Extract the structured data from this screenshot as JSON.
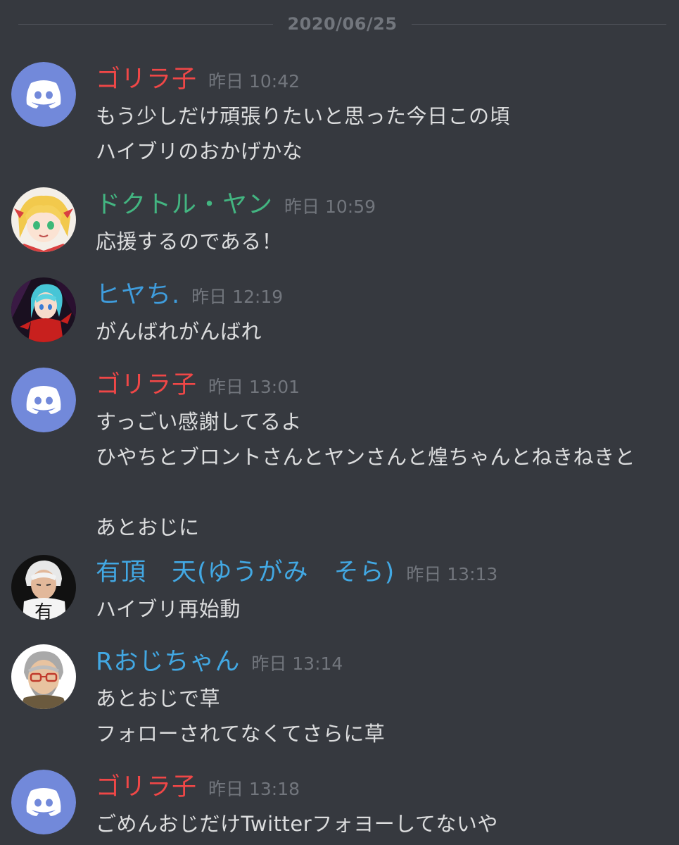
{
  "date_divider": "2020/06/25",
  "colors": {
    "red": "#f04747",
    "green": "#43b581",
    "blue": "#3f9ddd",
    "background": "#36393f",
    "discord_blurple": "#7289da"
  },
  "messages": [
    {
      "author": "ゴリラ子",
      "author_color": "red",
      "avatar": "discord-default-avatar",
      "timestamp": "昨日 10:42",
      "lines": [
        "もう少しだけ頑張りたいと思った今日この頃",
        "ハイブリのおかげかな"
      ]
    },
    {
      "author": "ドクトル・ヤン",
      "author_color": "green",
      "avatar": "anime-blonde-girl-avatar",
      "timestamp": "昨日 10:59",
      "lines": [
        "応援するのである！"
      ]
    },
    {
      "author": "ヒヤち.",
      "author_color": "blue",
      "avatar": "anime-cyan-hair-avatar",
      "timestamp": "昨日 12:19",
      "lines": [
        "がんばれがんばれ"
      ]
    },
    {
      "author": "ゴリラ子",
      "author_color": "red",
      "avatar": "discord-default-avatar",
      "timestamp": "昨日 13:01",
      "lines": [
        "すっごい感謝してるよ",
        "ひやちとブロントさんとヤンさんと煌ちゃんとねきねきと",
        "",
        "あとおじに"
      ]
    },
    {
      "author": "有頂　天(ゆうがみ　そら)",
      "author_color": "blue",
      "avatar": "white-hair-man-avatar",
      "avatar_text": "有",
      "timestamp": "昨日 13:13",
      "lines": [
        "ハイブリ再始動"
      ]
    },
    {
      "author": "Rおじちゃん",
      "author_color": "blue",
      "avatar": "old-man-glasses-avatar",
      "timestamp": "昨日 13:14",
      "lines": [
        "あとおじで草",
        "フォローされてなくてさらに草"
      ]
    },
    {
      "author": "ゴリラ子",
      "author_color": "red",
      "avatar": "discord-default-avatar",
      "timestamp": "昨日 13:18",
      "lines": [
        "ごめんおじだけTwitterフォヨーしてないや"
      ]
    }
  ]
}
